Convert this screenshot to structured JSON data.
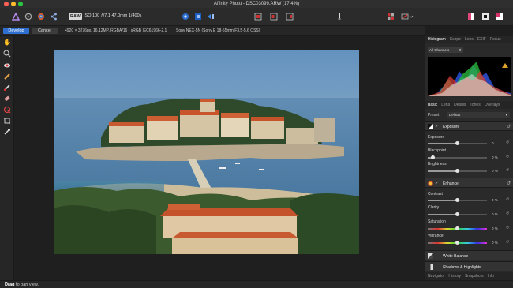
{
  "window": {
    "title": "Affinity Photo - DSC03099.ARW (17.4%)"
  },
  "colors": {
    "accent": "#2f6fd0",
    "close": "#fc5f57",
    "minimize": "#fdbc2e",
    "maximize": "#29c840"
  },
  "toolbar": {
    "raw_badge": "RAW",
    "exif": "ISO 100 ƒ/7.1 47.0mm 1/400s",
    "icons": [
      "affinity-logo-icon",
      "persona-photo-icon",
      "persona-liquify-icon",
      "persona-develop-icon",
      "share-icon",
      "view-icon",
      "split-view-icon",
      "mirror-view-icon",
      "overlay-icon",
      "brush-options-icon",
      "color-picker-icon",
      "quickmask-icon",
      "swatch-icon"
    ]
  },
  "context": {
    "develop_label": "Develop",
    "cancel_label": "Cancel",
    "image_info": "4920 × 3276px, 16.12MP, RGBA/16 - sRGB IEC61966-2.1",
    "camera_info": "Sony NEX-5N (Sony E 18-55mm F3.5-5.6 OSS)"
  },
  "tools": [
    "hand-tool-icon",
    "zoom-tool-icon",
    "red-eye-tool-icon",
    "blemish-tool-icon",
    "overlay-paint-tool-icon",
    "overlay-erase-tool-icon",
    "overlay-gradient-tool-icon",
    "crop-tool-icon",
    "white-balance-tool-icon"
  ],
  "panel": {
    "top_tabs": [
      "Histogram",
      "Scope",
      "Lens",
      "EXIF",
      "Focus"
    ],
    "histogram_channel": "All Channels",
    "mid_tabs": [
      "Basic",
      "Lens",
      "Details",
      "Tones",
      "Overlays"
    ],
    "preset_label": "Preset:",
    "preset_value": "Default",
    "sections": {
      "exposure": "Exposure",
      "enhance": "Enhance",
      "white_balance": "White Balance",
      "shadows_highlights": "Shadows & Highlights"
    },
    "params": {
      "exposure": {
        "label": "Exposure",
        "value": "0",
        "level": 0.5
      },
      "blackpoint": {
        "label": "Blackpoint",
        "value": "0 %",
        "level": 0.08
      },
      "brightness": {
        "label": "Brightness",
        "value": "0 %",
        "level": 0.5
      },
      "contrast": {
        "label": "Contrast",
        "value": "0 %",
        "level": 0.5
      },
      "clarity": {
        "label": "Clarity",
        "value": "0 %",
        "level": 0.5
      },
      "saturation": {
        "label": "Saturation",
        "value": "0 %",
        "level": 0.5
      },
      "vibrance": {
        "label": "Vibrance",
        "value": "0 %",
        "level": 0.5
      }
    },
    "bottom_tabs": [
      "Navigator",
      "History",
      "Snapshots",
      "Info"
    ]
  },
  "status": {
    "bold": "Drag",
    "text": " to pan view."
  }
}
